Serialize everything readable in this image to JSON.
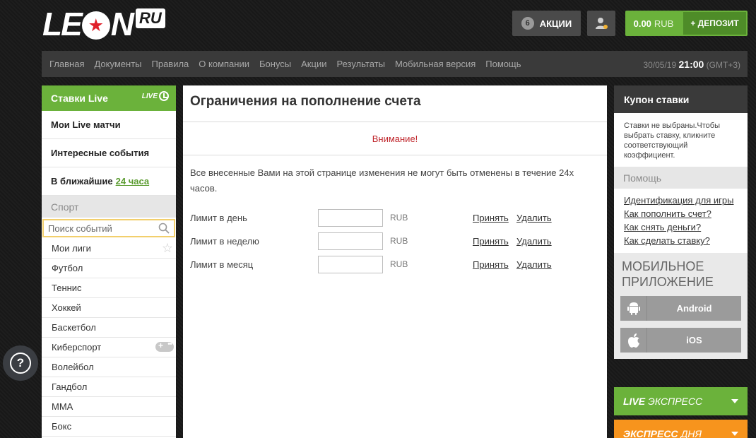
{
  "header": {
    "logo": {
      "text_left": "LE",
      "text_right": "N",
      "badge": "RU"
    },
    "promo": {
      "count": "6",
      "label": "АКЦИИ"
    },
    "balance": {
      "amount": "0.00",
      "currency": "RUB",
      "deposit_label": "+ ДЕПОЗИТ"
    }
  },
  "topnav": {
    "items": [
      "Главная",
      "Документы",
      "Правила",
      "О компании",
      "Бонусы",
      "Акции",
      "Результаты",
      "Мобильная версия",
      "Помощь"
    ],
    "date": "30/05/19",
    "time": "21:00",
    "timezone": "(GMT+3)"
  },
  "left": {
    "live_title": "Ставки Live",
    "live_badge": "LIVE",
    "links": {
      "my_live": "Мои Live матчи",
      "interesting": "Интересные события",
      "upcoming_prefix": "В ближайшие",
      "upcoming_link": "24 часа"
    },
    "sport_title": "Спорт",
    "search_placeholder": "Поиск событий",
    "sports": [
      "Мои лиги",
      "Футбол",
      "Теннис",
      "Хоккей",
      "Баскетбол",
      "Киберспорт",
      "Волейбол",
      "Гандбол",
      "MMA",
      "Бокс"
    ]
  },
  "main": {
    "title": "Ограничения на пополнение счета",
    "attention": "Внимание!",
    "notice": "Все внесенные Вами на этой странице изменения не могут быть отменены в течение 24х часов.",
    "limits": [
      {
        "label": "Лимит в день",
        "value": "",
        "currency": "RUB",
        "accept": "Принять",
        "remove": "Удалить"
      },
      {
        "label": "Лимит в неделю",
        "value": "",
        "currency": "RUB",
        "accept": "Принять",
        "remove": "Удалить"
      },
      {
        "label": "Лимит в месяц",
        "value": "",
        "currency": "RUB",
        "accept": "Принять",
        "remove": "Удалить"
      }
    ]
  },
  "right": {
    "coupon_title": "Купон ставки",
    "coupon_text": "Ставки не выбраны.Чтобы выбрать ставку, кликните соответствующий коэффициент.",
    "help_title": "Помощь",
    "help_links": [
      "Идентификация для игры",
      "Как пополнить счет?",
      "Как снять деньги?",
      "Как сделать ставку?"
    ],
    "mobile_title_1": "МОБИЛЬНОЕ",
    "mobile_title_2": "ПРИЛОЖЕНИЕ",
    "android_label": "Android",
    "ios_label": "iOS",
    "live_express_em": "LIVE",
    "live_express_text": "ЭКСПРЕСС",
    "express_day_em": "ЭКСПРЕСС",
    "express_day_text": "ДНЯ"
  },
  "colors": {
    "green": "#6bb23b",
    "orange": "#f7941d",
    "dark": "#3a3a3a",
    "attention_red": "#c0272d"
  },
  "icons": {
    "promo": "counter-badge",
    "user": "user-icon",
    "search": "search-icon",
    "star": "star-icon",
    "gamepad": "gamepad-icon",
    "android": "android-icon",
    "apple": "apple-icon",
    "help": "question-icon",
    "caret": "chevron-down-icon"
  }
}
